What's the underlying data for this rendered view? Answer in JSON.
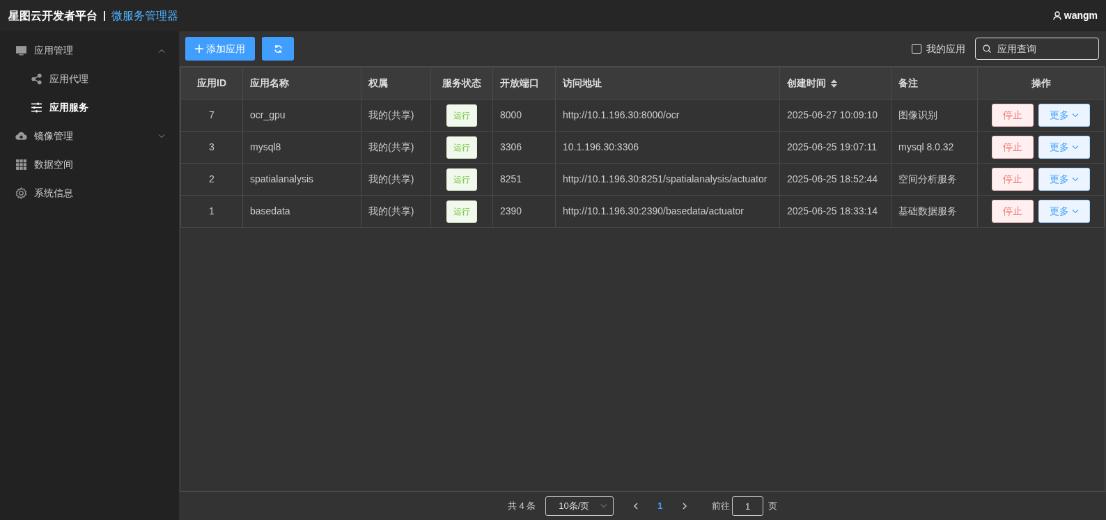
{
  "header": {
    "title": "星图云开发者平台",
    "separator": "|",
    "subtitle": "微服务管理器",
    "user": "wangm"
  },
  "sidebar": {
    "items": [
      {
        "label": "应用管理",
        "expanded": true,
        "selected": false,
        "children": [
          {
            "label": "应用代理",
            "selected": false
          },
          {
            "label": "应用服务",
            "selected": true
          }
        ]
      },
      {
        "label": "镜像管理",
        "expanded": false,
        "selected": false
      },
      {
        "label": "数据空间",
        "selected": false
      },
      {
        "label": "系统信息",
        "selected": false
      }
    ]
  },
  "toolbar": {
    "add_button": "添加应用",
    "my_apps": {
      "label": "我的应用",
      "checked": false
    },
    "search": {
      "placeholder": "应用查询"
    }
  },
  "table": {
    "columns": [
      {
        "label": "应用ID",
        "sortable": false
      },
      {
        "label": "应用名称",
        "sortable": false
      },
      {
        "label": "权属",
        "sortable": false
      },
      {
        "label": "服务状态",
        "sortable": false
      },
      {
        "label": "开放端口",
        "sortable": false
      },
      {
        "label": "访问地址",
        "sortable": false
      },
      {
        "label": "创建时间",
        "sortable": true
      },
      {
        "label": "备注",
        "sortable": false
      },
      {
        "label": "操作",
        "sortable": false
      }
    ],
    "rows": [
      {
        "id": "7",
        "name": "ocr_gpu",
        "owner": "我的(共享)",
        "status": "运行",
        "port": "8000",
        "url": "http://10.1.196.30:8000/ocr",
        "created": "2025-06-27 10:09:10",
        "note": "图像识别",
        "stop": "停止",
        "more": "更多"
      },
      {
        "id": "3",
        "name": "mysql8",
        "owner": "我的(共享)",
        "status": "运行",
        "port": "3306",
        "url": "10.1.196.30:3306",
        "created": "2025-06-25 19:07:11",
        "note": "mysql 8.0.32",
        "stop": "停止",
        "more": "更多"
      },
      {
        "id": "2",
        "name": "spatialanalysis",
        "owner": "我的(共享)",
        "status": "运行",
        "port": "8251",
        "url": "http://10.1.196.30:8251/spatialanalysis/actuator",
        "created": "2025-06-25 18:52:44",
        "note": "空间分析服务",
        "stop": "停止",
        "more": "更多"
      },
      {
        "id": "1",
        "name": "basedata",
        "owner": "我的(共享)",
        "status": "运行",
        "port": "2390",
        "url": "http://10.1.196.30:2390/basedata/actuator",
        "created": "2025-06-25 18:33:14",
        "note": "基础数据服务",
        "stop": "停止",
        "more": "更多"
      }
    ]
  },
  "pagination": {
    "total": "共 4 条",
    "page_size": "10条/页",
    "pages": [
      {
        "label": "1",
        "selected": true
      }
    ],
    "goto_label": "前往",
    "goto_value": "1",
    "goto_suffix": "页"
  }
}
